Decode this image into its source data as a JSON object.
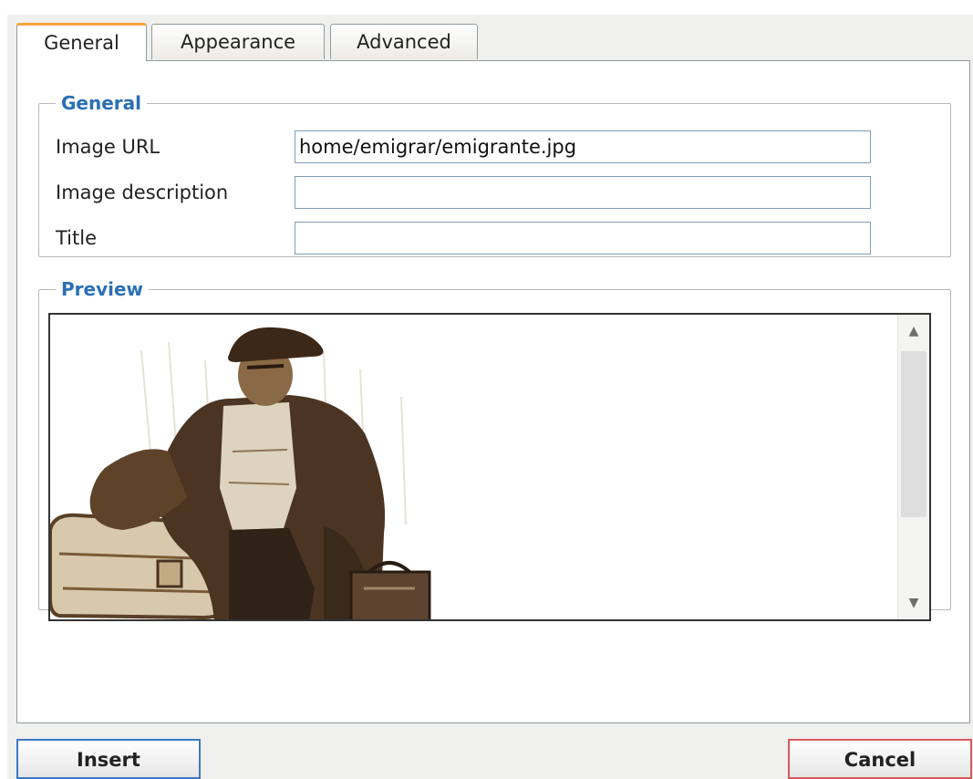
{
  "tabs": [
    {
      "label": "General",
      "active": true
    },
    {
      "label": "Appearance",
      "active": false
    },
    {
      "label": "Advanced",
      "active": false
    }
  ],
  "general": {
    "legend": "General",
    "fields": [
      {
        "label": "Image URL",
        "value": "home/emigrar/emigrante.jpg"
      },
      {
        "label": "Image description",
        "value": ""
      },
      {
        "label": "Title",
        "value": ""
      }
    ]
  },
  "preview": {
    "legend": "Preview",
    "image": "emigrant-illustration"
  },
  "buttons": {
    "insert": "Insert",
    "cancel": "Cancel"
  },
  "colors": {
    "accent_tab": "#f8a43b",
    "legend_text": "#2b6fb6",
    "insert_border": "#3b79c4",
    "cancel_border": "#d55a5a"
  }
}
